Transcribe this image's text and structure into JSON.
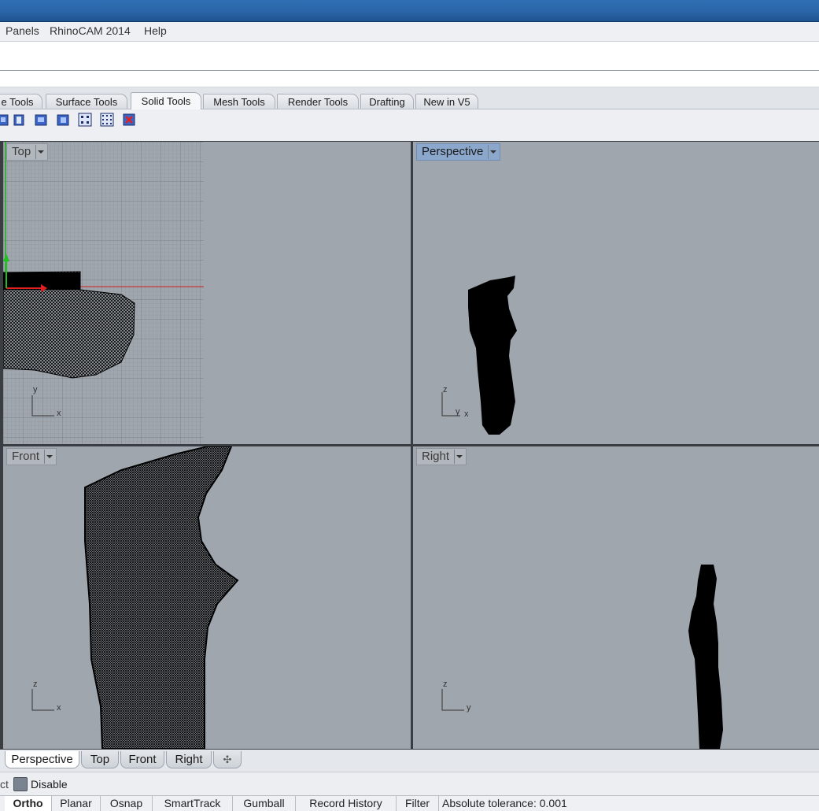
{
  "menu": {
    "items": [
      {
        "label": "Panels"
      },
      {
        "label": "RhinoCAM 2014"
      },
      {
        "label": "Help"
      }
    ]
  },
  "toolbar_tabs": [
    {
      "label": "e Tools"
    },
    {
      "label": "Surface Tools"
    },
    {
      "label": "Solid Tools",
      "active": true
    },
    {
      "label": "Mesh Tools"
    },
    {
      "label": "Render Tools"
    },
    {
      "label": "Drafting"
    },
    {
      "label": "New in V5"
    }
  ],
  "tool_icons": [
    "solid-box-icon",
    "solid-cylinder-icon",
    "solid-extrude-icon",
    "solid-boolean-icon",
    "solid-array-icon",
    "solid-grid-icon",
    "solid-delete-icon"
  ],
  "viewports": {
    "top": {
      "label": "Top",
      "axis1": "y",
      "axis2": "x"
    },
    "perspective": {
      "label": "Perspective",
      "axis1": "z",
      "axis2": "y",
      "axis3": "x"
    },
    "front": {
      "label": "Front",
      "axis1": "z",
      "axis2": "x"
    },
    "right": {
      "label": "Right",
      "axis1": "z",
      "axis2": "y"
    }
  },
  "viewport_tabs": [
    {
      "label": "Perspective",
      "active": true
    },
    {
      "label": "Top"
    },
    {
      "label": "Front"
    },
    {
      "label": "Right"
    }
  ],
  "osnap": {
    "prefix": "ct",
    "disable_label": "Disable"
  },
  "status": {
    "panes": [
      {
        "label": "Ortho",
        "on": true
      },
      {
        "label": "Planar"
      },
      {
        "label": "Osnap"
      },
      {
        "label": "SmartTrack"
      },
      {
        "label": "Gumball"
      },
      {
        "label": "Record History"
      },
      {
        "label": "Filter"
      }
    ],
    "tolerance": "Absolute tolerance: 0.001"
  },
  "colors": {
    "title": "#2a65a8",
    "viewport_bg": "#a0a6ad",
    "active_label": "#8ba7cc",
    "x_axis": "#d02020",
    "y_axis": "#20b020"
  }
}
